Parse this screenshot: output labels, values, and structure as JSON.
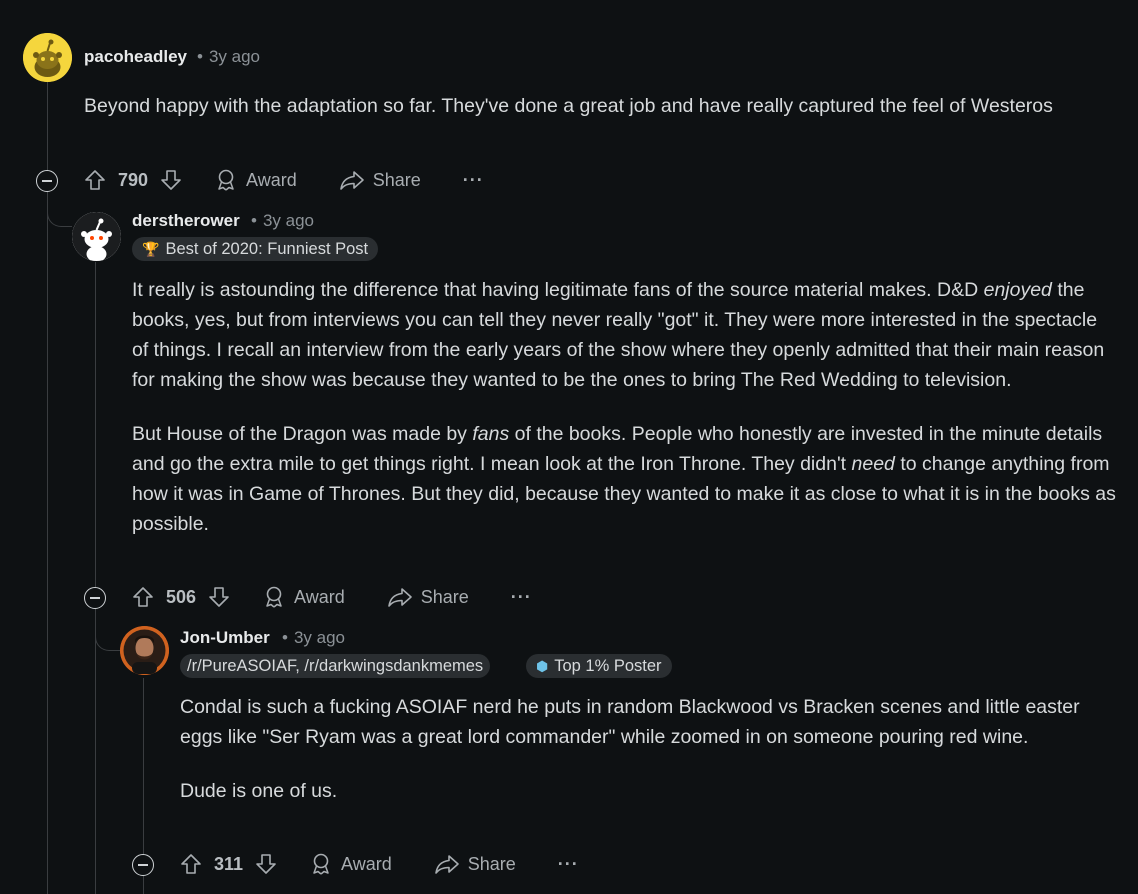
{
  "comments": [
    {
      "username": "pacoheadley",
      "time": "3y ago",
      "body": [
        "Beyond happy with the adaptation so far. They've done a great job and have really captured the feel of Westeros"
      ],
      "votes": "790",
      "award_label": "Award",
      "share_label": "Share",
      "more_label": "···"
    },
    {
      "username": "derstherower",
      "time": "3y ago",
      "flair": "Best of 2020: Funniest Post",
      "p1_a": "It really is astounding the difference that having legitimate fans of the source material makes. D&D ",
      "p1_em": "enjoyed",
      "p1_b": " the books, yes, but from interviews you can tell they never really \"got\" it. They were more interested in the spectacle of things. I recall an interview from the early years of the show where they openly admitted that their main reason for making the show was because they wanted to be the ones to bring The Red Wedding to television.",
      "p2_a": "But House of the Dragon was made by ",
      "p2_em1": "fans",
      "p2_b": " of the books. People who honestly are invested in the minute details and go the extra mile to get things right. I mean look at the Iron Throne. They didn't ",
      "p2_em2": "need",
      "p2_c": " to change anything from how it was in Game of Thrones. But they did, because they wanted to make it as close to what it is in the books as possible.",
      "votes": "506",
      "award_label": "Award",
      "share_label": "Share",
      "more_label": "···"
    },
    {
      "username": "Jon-Umber",
      "time": "3y ago",
      "flair_subs": "/r/PureASOIAF, /r/darkwingsdankmemes",
      "flair_top": "Top 1% Poster",
      "p1": "Condal is such a fucking ASOIAF nerd he puts in random Blackwood vs Bracken scenes and little easter eggs like \"Ser Ryam was a great lord commander\" while zoomed in on someone pouring red wine.",
      "p2": "Dude is one of us.",
      "votes": "311",
      "award_label": "Award",
      "share_label": "Share",
      "more_label": "···"
    }
  ]
}
